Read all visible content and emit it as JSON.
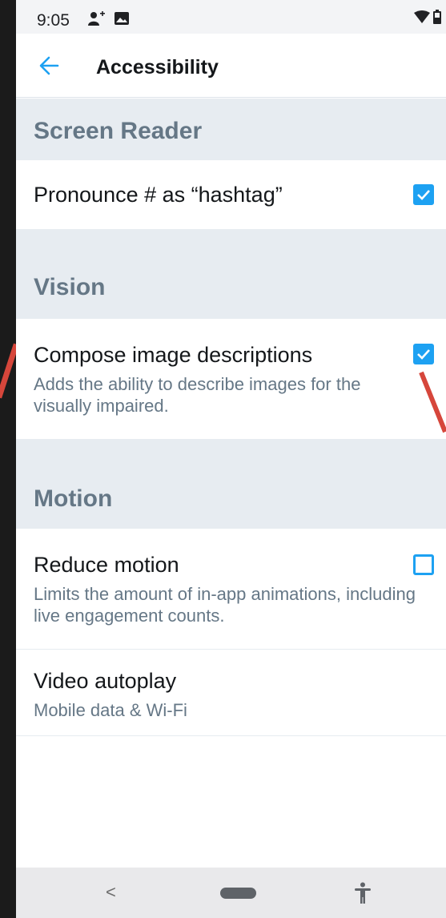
{
  "status_bar": {
    "time": "9:05"
  },
  "header": {
    "title": "Accessibility"
  },
  "sections": [
    {
      "title": "Screen Reader",
      "items": [
        {
          "title": "Pronounce # as “hashtag”",
          "checked": true
        }
      ]
    },
    {
      "title": "Vision",
      "items": [
        {
          "title": "Compose image descriptions",
          "description": "Adds the ability to describe images for the visually impaired.",
          "checked": true
        }
      ]
    },
    {
      "title": "Motion",
      "items": [
        {
          "title": "Reduce motion",
          "description": "Limits the amount of in-app animations, including live engagement counts.",
          "checked": false
        },
        {
          "title": "Video autoplay",
          "value": "Mobile data & Wi-Fi"
        }
      ]
    }
  ],
  "nav_bar": {
    "back": "<"
  },
  "colors": {
    "accent": "#1da1f2",
    "section_bg": "#e7ecf1",
    "secondary_text": "#657786",
    "annotation": "#d6463b"
  }
}
